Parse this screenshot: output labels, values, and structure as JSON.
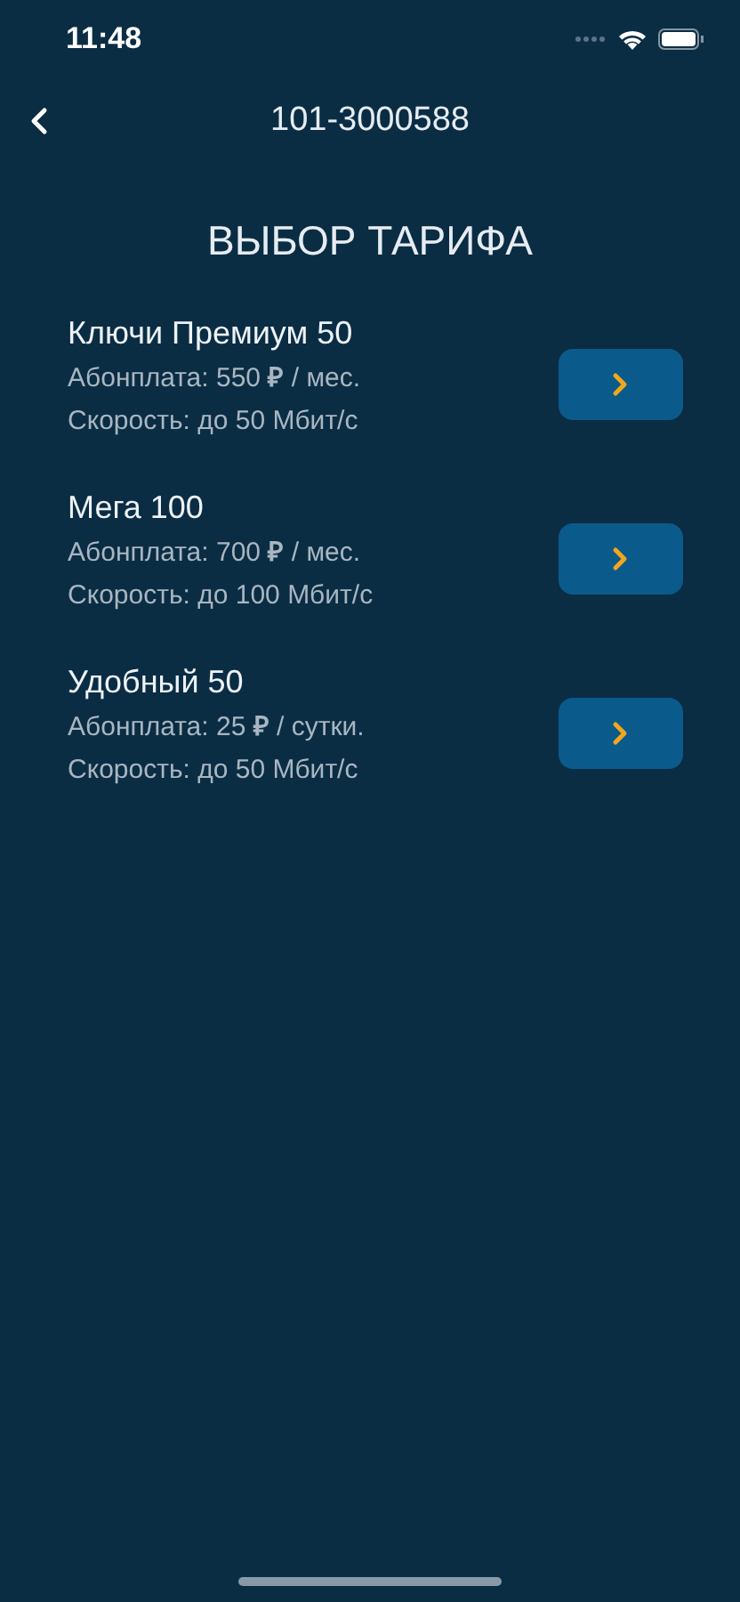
{
  "status_bar": {
    "time": "11:48"
  },
  "nav": {
    "title": "101-3000588"
  },
  "heading": "ВЫБОР ТАРИФА",
  "tariffs": [
    {
      "name": "Ключи Премиум 50",
      "fee": "Абонплата: 550 **₽** / мес.",
      "speed": "Скорость: до 50 Мбит/с"
    },
    {
      "name": "Мега 100",
      "fee": "Абонплата: 700 **₽** / мес.",
      "speed": "Скорость: до 100 Мбит/с"
    },
    {
      "name": "Удобный 50",
      "fee": "Абонплата: 25 **₽** / сутки.",
      "speed": "Скорость: до 50 Мбит/с"
    }
  ]
}
